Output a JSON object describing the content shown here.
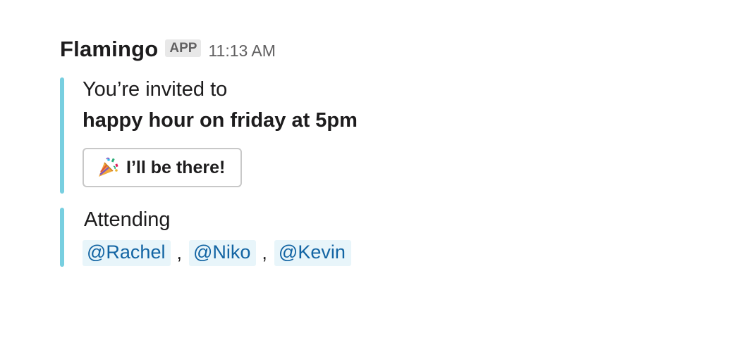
{
  "message": {
    "sender": "Flamingo",
    "badge": "APP",
    "timestamp": "11:13 AM"
  },
  "invite": {
    "intro": "You’re invited to",
    "event": "happy hour on friday at 5pm",
    "button_label": "I’ll be there!",
    "button_icon": "party-popper-icon",
    "accent_color": "#78cfe0"
  },
  "attending": {
    "label": "Attending",
    "users": [
      "@Rachel",
      "@Niko",
      "@Kevin"
    ],
    "separator": ","
  }
}
